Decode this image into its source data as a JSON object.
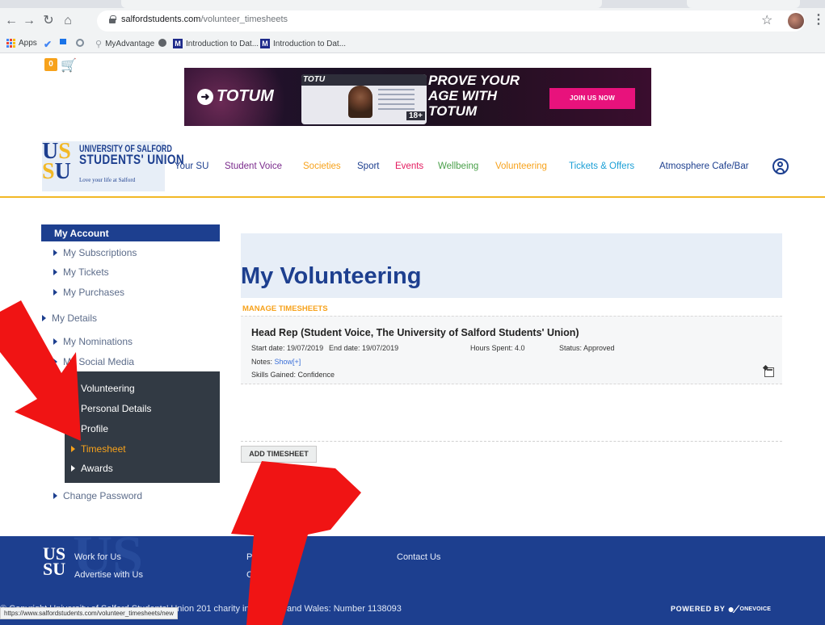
{
  "browser": {
    "url_host": "salfordstudents.com",
    "url_path": "/volunteer_timesheets",
    "bookmarks": [
      "Apps",
      "MyAdvantage",
      "Introduction to Dat...",
      "Introduction to Dat..."
    ]
  },
  "cart": {
    "count": "0"
  },
  "banner": {
    "logo": "TOTUM",
    "card_logo": "TOTU",
    "card_age": "18+",
    "headline": [
      "PROVE YOUR",
      "AGE WITH",
      "TOTUM"
    ],
    "cta": "JOIN US NOW"
  },
  "brand": {
    "line1": "UNIVERSITY OF SALFORD",
    "line2": "STUDENTS' UNION",
    "tagline": "Love your life at Salford"
  },
  "nav": [
    {
      "label": "Your SU",
      "color": "#1d3f8f"
    },
    {
      "label": "Student Voice",
      "color": "#7a2a8c"
    },
    {
      "label": "Societies",
      "color": "#f7a21b"
    },
    {
      "label": "Sport",
      "color": "#1d3f8f"
    },
    {
      "label": "Events",
      "color": "#e31b5f"
    },
    {
      "label": "Wellbeing",
      "color": "#4aa04a"
    },
    {
      "label": "Volunteering",
      "color": "#f7a21b"
    },
    {
      "label": "Tickets & Offers",
      "color": "#1a9fd6"
    },
    {
      "label": "Atmosphere Cafe/Bar",
      "color": "#1d3f8f"
    }
  ],
  "sidebar": {
    "header": "My Account",
    "items": [
      "My Subscriptions",
      "My Tickets",
      "My Purchases",
      "My Details",
      "My Nominations",
      "My Social Media"
    ],
    "volunteering": [
      "Volunteering",
      "Personal Details",
      "Profile",
      "Timesheet",
      "Awards"
    ],
    "change_password": "Change Password"
  },
  "main": {
    "title": "My Volunteering",
    "section": "MANAGE TIMESHEETS",
    "entry": {
      "title": "Head Rep (Student Voice, The University of Salford Students' Union)",
      "start": "Start date: 19/07/2019",
      "end": "End date: 19/07/2019",
      "hours": "Hours Spent: 4.0",
      "status": "Status: Approved",
      "notes_label": "Notes:",
      "notes_link": "Show[+]",
      "skills": "Skills Gained: Confidence"
    },
    "add_button": "ADD TIMESHEET"
  },
  "footer": {
    "links_col1": [
      "Work for Us",
      "Advertise with Us"
    ],
    "links_col2": [
      "Priva",
      "Cook"
    ],
    "links_col3": [
      "Contact Us"
    ],
    "copyright": "© Copyright University of Salford Students' Union 201   charity in England and Wales: Number 1138093",
    "powered": "POWERED BY",
    "powered_brand": "ONEVOICE"
  },
  "status_bar_url": "https://www.salfordstudents.com/volunteer_timesheets/new",
  "colors": {
    "brand_blue": "#1d3f8f",
    "accent_orange": "#f7a21b",
    "sidebar_dark": "#323a44",
    "annotation_red": "#f01414"
  }
}
